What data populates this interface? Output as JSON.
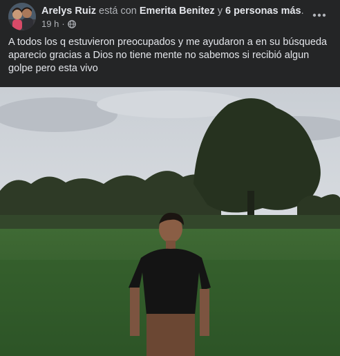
{
  "post": {
    "author": "Arelys Ruiz",
    "with_text": "está con",
    "tagged": "Emerita Benitez",
    "and_text": "y",
    "others": "6 personas más",
    "period": ".",
    "time": "19 h",
    "separator": "·",
    "audience_icon": "globe-icon",
    "more_icon": "more-horizontal-icon",
    "text": "A todos los q estuvieron preocupados y me ayudaron a en su búsqueda aparecio gracias a Dios no tiene mente no sabemos si recibió algun golpe pero esta vivo"
  },
  "colors": {
    "background": "#242526",
    "primary_text": "#e4e6eb",
    "secondary_text": "#b0b3b8"
  }
}
